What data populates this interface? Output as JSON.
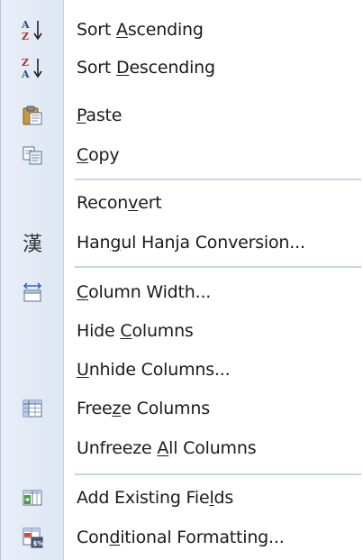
{
  "menu": {
    "items": [
      {
        "icon": "sort-ascending-icon",
        "before": "Sort ",
        "accel": "A",
        "after": "scending"
      },
      {
        "icon": "sort-descending-icon",
        "before": "Sort ",
        "accel": "D",
        "after": "escending"
      },
      {
        "icon": "paste-icon",
        "before": "",
        "accel": "P",
        "after": "aste"
      },
      {
        "icon": "copy-icon",
        "before": "",
        "accel": "C",
        "after": "opy"
      },
      {
        "icon": "",
        "before": "Recon",
        "accel": "v",
        "after": "ert"
      },
      {
        "icon": "hanja-icon",
        "before": "Han",
        "accel": "g",
        "after": "ul Hanja Conversion..."
      },
      {
        "icon": "column-width-icon",
        "before": "",
        "accel": "C",
        "after": "olumn Width..."
      },
      {
        "icon": "",
        "before": "Hide ",
        "accel": "C",
        "after": "olumns"
      },
      {
        "icon": "",
        "before": "",
        "accel": "U",
        "after": "nhide Columns..."
      },
      {
        "icon": "freeze-columns-icon",
        "before": "Free",
        "accel": "z",
        "after": "e Columns"
      },
      {
        "icon": "",
        "before": "Unfreeze ",
        "accel": "A",
        "after": "ll Columns"
      },
      {
        "icon": "add-fields-icon",
        "before": "Add Existing Fie",
        "accel": "l",
        "after": "ds"
      },
      {
        "icon": "conditional-formatting-icon",
        "before": "Con",
        "accel": "d",
        "after": "itional Formatting..."
      }
    ]
  },
  "icons": {
    "hanja_glyph": "漢"
  },
  "colors": {
    "gutter": "#dde6f3",
    "separator": "#c5d5ea",
    "text": "#1a1a1a"
  }
}
